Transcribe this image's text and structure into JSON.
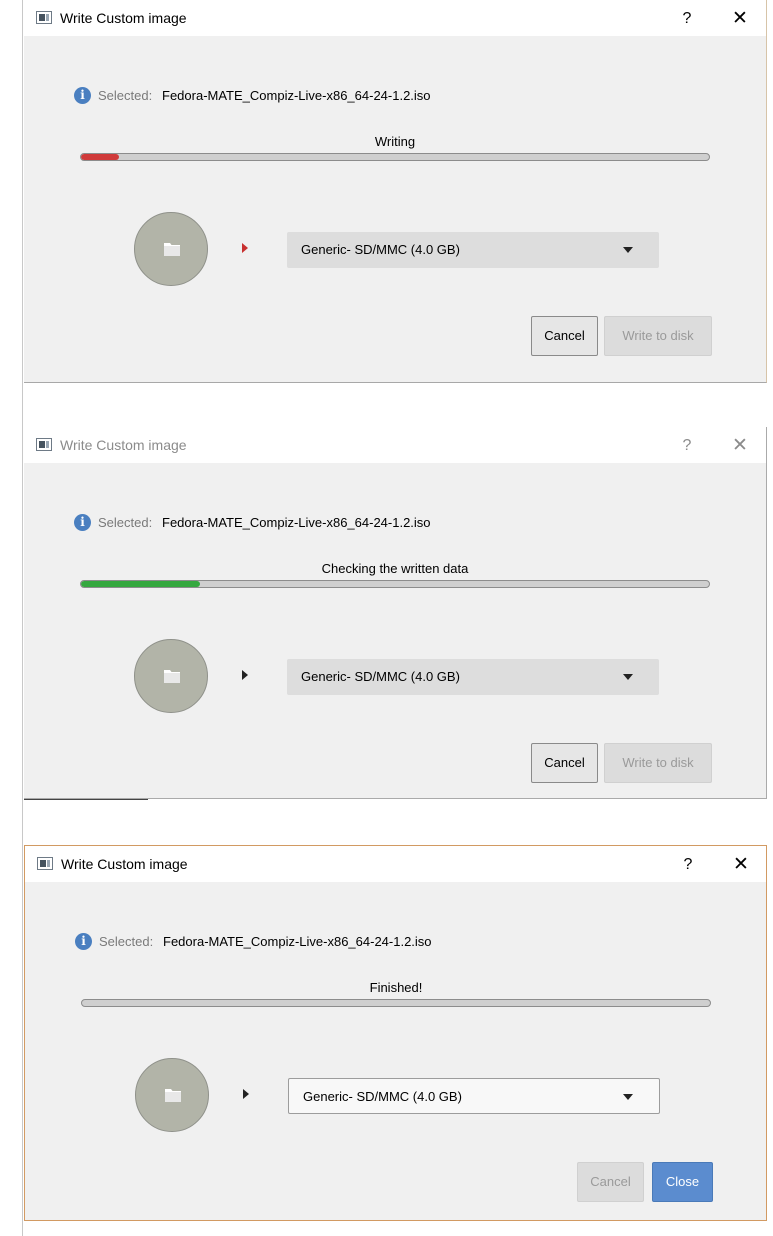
{
  "colors": {
    "progress_writing": "#d03a3a",
    "progress_checking": "#35a83f",
    "info_icon": "#4a7fc0",
    "close_button": "#5b8ccf"
  },
  "dialogs": [
    {
      "title": "Write Custom image",
      "help_label": "?",
      "close_label": "✕",
      "selected_label": "Selected:",
      "selected_file": "Fedora-MATE_Compiz-Live-x86_64-24-1.2.iso",
      "status": "Writing",
      "progress": 0.06,
      "drive": "Generic- SD/MMC (4.0 GB)",
      "cancel_label": "Cancel",
      "write_label": "Write to disk",
      "icons": [
        "app-icon",
        "info-icon",
        "folder-icon",
        "play-arrow-icon",
        "chevron-down-icon"
      ]
    },
    {
      "title": "Write Custom image",
      "help_label": "?",
      "close_label": "✕",
      "selected_label": "Selected:",
      "selected_file": "Fedora-MATE_Compiz-Live-x86_64-24-1.2.iso",
      "status": "Checking the written data",
      "progress": 0.19,
      "drive": "Generic- SD/MMC (4.0 GB)",
      "cancel_label": "Cancel",
      "write_label": "Write to disk",
      "icons": [
        "app-icon",
        "info-icon",
        "folder-icon",
        "play-arrow-icon",
        "chevron-down-icon"
      ]
    },
    {
      "title": "Write Custom image",
      "help_label": "?",
      "close_label": "✕",
      "selected_label": "Selected:",
      "selected_file": "Fedora-MATE_Compiz-Live-x86_64-24-1.2.iso",
      "status": "Finished!",
      "progress": 0,
      "drive": "Generic- SD/MMC (4.0 GB)",
      "cancel_label": "Cancel",
      "close_button_label": "Close",
      "icons": [
        "app-icon",
        "info-icon",
        "folder-icon",
        "play-arrow-icon",
        "chevron-down-icon"
      ]
    }
  ]
}
